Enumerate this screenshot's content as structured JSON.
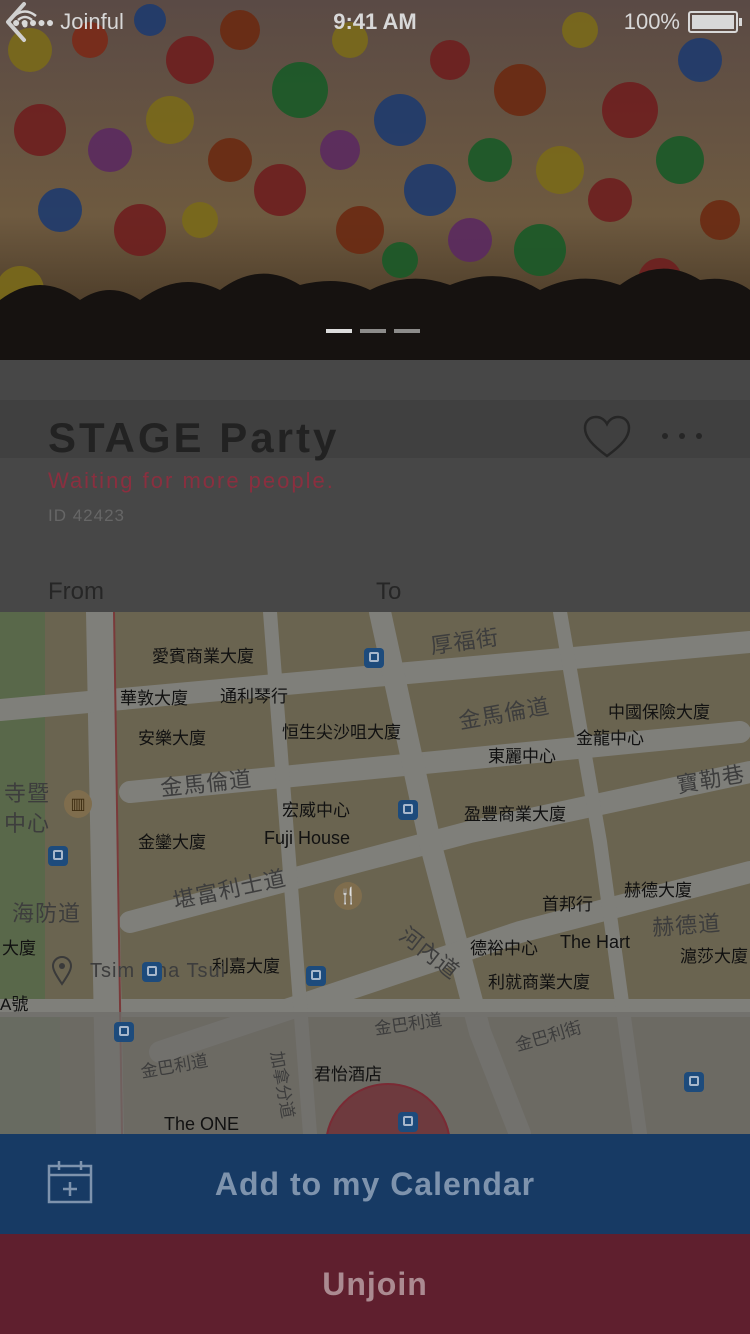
{
  "status_bar": {
    "carrier_dots": "●●●●●",
    "carrier": "Joinful",
    "time": "9:41 AM",
    "battery": "100%"
  },
  "event": {
    "title": "STAGE Party",
    "status": "Waiting for more people.",
    "id_label": "ID 42423"
  },
  "route": {
    "from_label": "From",
    "to_label": "To"
  },
  "map": {
    "labels": {
      "l1": "愛賓商業大廈",
      "l2": "厚福街",
      "l3": "華敦大廈",
      "l4": "通利琴行",
      "l5": "中國保險大廈",
      "l6": "安樂大廈",
      "l7": "恒生尖沙咀大廈",
      "l8": "金馬倫道",
      "l9": "金龍中心",
      "l10": "東麗中心",
      "l11": "寺暨",
      "l12": "中心",
      "l13": "金馬倫道",
      "l14": "宏威中心",
      "l15": "盈豐商業大廈",
      "l16": "寶勒巷",
      "l17": "金鑾大廈",
      "l18": "Fuji House",
      "l19": "海防道",
      "l20": "堪富利士道",
      "l21": "首邦行",
      "l22": "赫德大廈",
      "l23": "赫德道",
      "l24": "大廈",
      "l25": "河內道",
      "l26": "德裕中心",
      "l27": "The Hart",
      "l28": "滬莎大廈",
      "l29": "利嘉大廈",
      "l30": "Tsim Sha Tsui",
      "l31": "利就商業大廈",
      "l32": "A號",
      "l33": "金巴利道",
      "l34": "金巴利道",
      "l35": "君怡酒店",
      "l36": "The ONE",
      "l37": "金巴利街",
      "l38": "加拿分道"
    }
  },
  "actions": {
    "add_calendar": "Add to my Calendar",
    "unjoin": "Unjoin"
  },
  "colors": {
    "calendar_bar": "#173a64",
    "unjoin_bar": "#5f1f2e",
    "status_accent": "#8a2f3f"
  }
}
